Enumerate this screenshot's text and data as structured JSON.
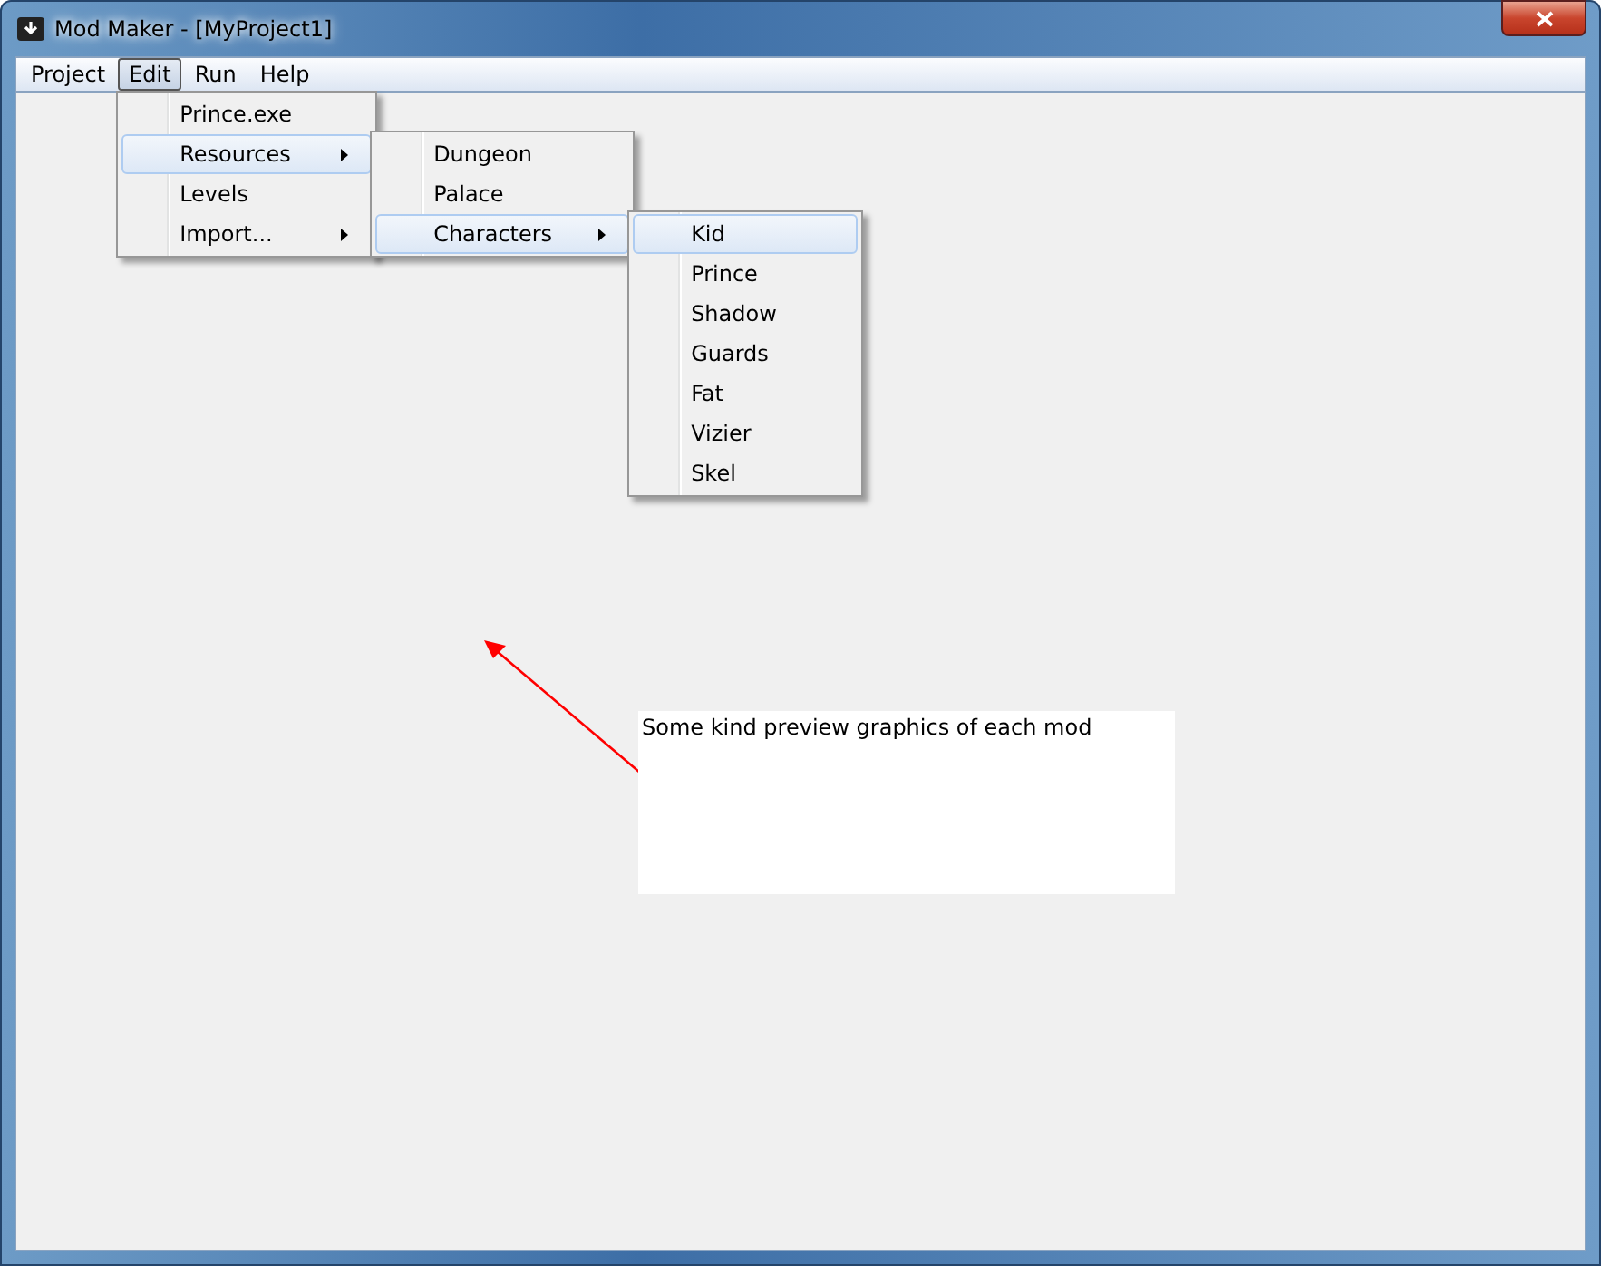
{
  "window": {
    "title": "Mod Maker - [MyProject1]"
  },
  "menu_bar": [
    {
      "label": "Project",
      "selected": false
    },
    {
      "label": "Edit",
      "selected": true,
      "menu": [
        {
          "label": "Prince.exe",
          "has_submenu": false,
          "selected": false
        },
        {
          "label": "Resources",
          "has_submenu": true,
          "selected": true,
          "children": [
            {
              "label": "Dungeon",
              "has_submenu": false,
              "selected": false
            },
            {
              "label": "Palace",
              "has_submenu": false,
              "selected": false
            },
            {
              "label": "Characters",
              "has_submenu": true,
              "selected": true,
              "children": [
                {
                  "label": "Kid",
                  "has_submenu": false,
                  "selected": true
                },
                {
                  "label": "Prince",
                  "has_submenu": false,
                  "selected": false
                },
                {
                  "label": "Shadow",
                  "has_submenu": false,
                  "selected": false
                },
                {
                  "label": "Guards",
                  "has_submenu": false,
                  "selected": false
                },
                {
                  "label": "Fat",
                  "has_submenu": false,
                  "selected": false
                },
                {
                  "label": "Vizier",
                  "has_submenu": false,
                  "selected": false
                },
                {
                  "label": "Skel",
                  "has_submenu": false,
                  "selected": false
                }
              ]
            }
          ]
        },
        {
          "label": "Levels",
          "has_submenu": false,
          "selected": false
        },
        {
          "label": "Import...",
          "has_submenu": true,
          "selected": false
        }
      ]
    },
    {
      "label": "Run",
      "selected": false
    },
    {
      "label": "Help",
      "selected": false
    }
  ],
  "annotation": {
    "text": "Some kind preview graphics of each mod"
  }
}
